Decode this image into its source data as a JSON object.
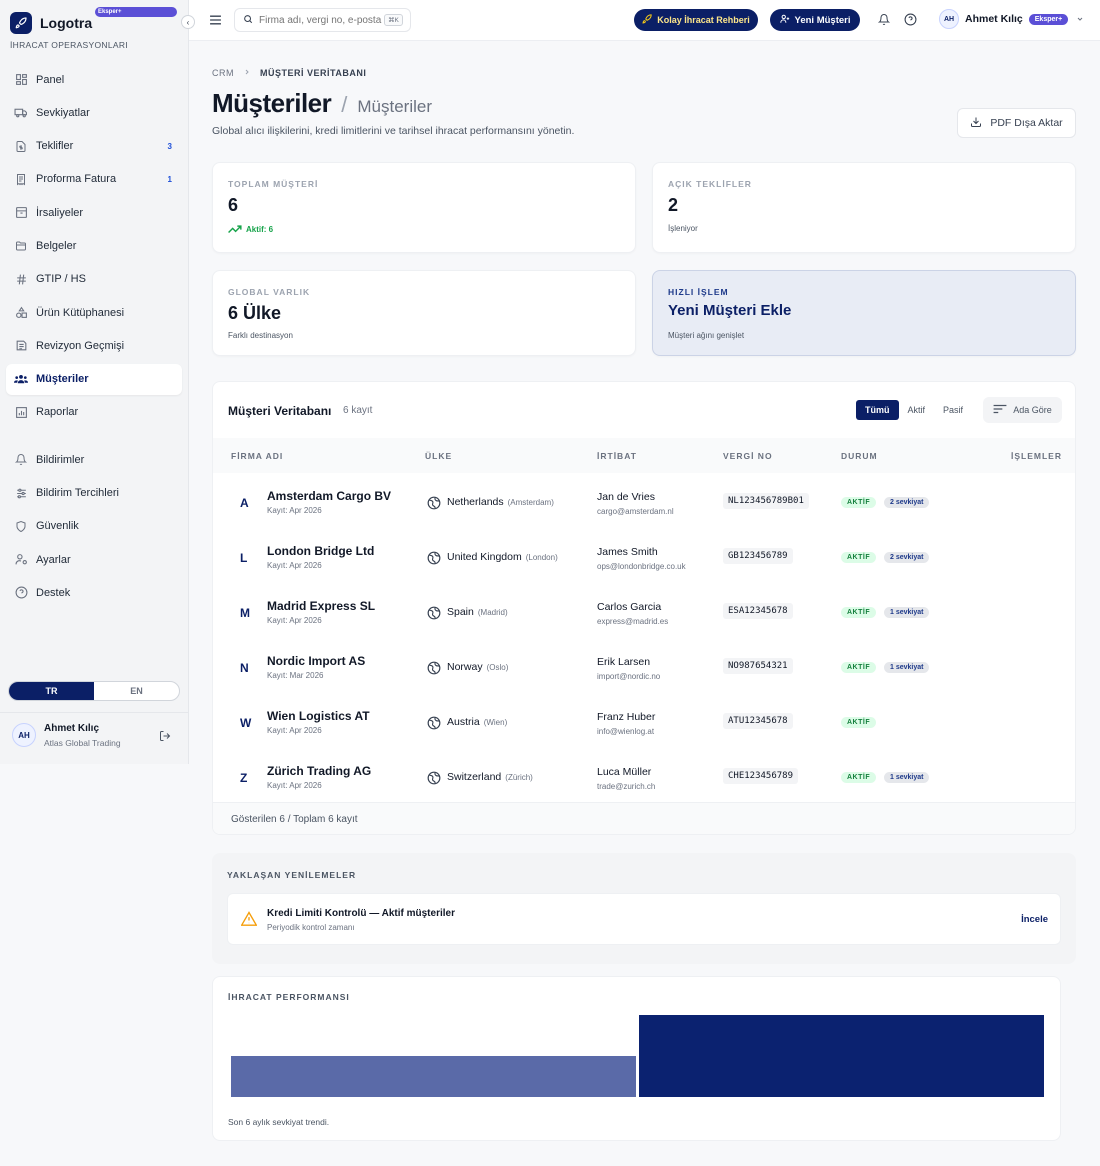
{
  "brand": {
    "name": "Logotra",
    "badge": "Eksper+",
    "subtitle": "İHRACAT OPERASYONLARI"
  },
  "sidebar": {
    "items": [
      {
        "label": "Panel",
        "icon": "grid-icon"
      },
      {
        "label": "Sevkiyatlar",
        "icon": "truck-icon"
      },
      {
        "label": "Teklifler",
        "icon": "document-dollar-icon",
        "count": "3"
      },
      {
        "label": "Proforma Fatura",
        "icon": "receipt-icon",
        "count": "1"
      },
      {
        "label": "İrsaliyeler",
        "icon": "archive-icon"
      },
      {
        "label": "Belgeler",
        "icon": "folder-icon"
      },
      {
        "label": "GTIP / HS",
        "icon": "hash-icon"
      },
      {
        "label": "Ürün Kütüphanesi",
        "icon": "shapes-icon"
      },
      {
        "label": "Revizyon Geçmişi",
        "icon": "history-icon"
      },
      {
        "label": "Müşteriler",
        "icon": "users-icon",
        "active": true
      },
      {
        "label": "Raporlar",
        "icon": "bar-chart-icon"
      }
    ],
    "items2": [
      {
        "label": "Bildirimler",
        "icon": "bell-icon"
      },
      {
        "label": "Bildirim Tercihleri",
        "icon": "sliders-icon"
      },
      {
        "label": "Güvenlik",
        "icon": "shield-icon"
      },
      {
        "label": "Ayarlar",
        "icon": "user-cog-icon"
      },
      {
        "label": "Destek",
        "icon": "help-circle-icon"
      }
    ],
    "lang": {
      "tr": "TR",
      "en": "EN"
    },
    "user": {
      "initials": "AH",
      "name": "Ahmet Kılıç",
      "company": "Atlas Global Trading"
    }
  },
  "topbar": {
    "search_placeholder": "Firma adı, vergi no, e-posta",
    "search_kbd": "⌘K",
    "guide_label": "Kolay İhracat Rehberi",
    "new_customer_label": "Yeni Müşteri",
    "user_initials": "AH",
    "user_name": "Ahmet Kılıç",
    "user_badge": "Eksper+"
  },
  "page": {
    "crumb1": "CRM",
    "crumb2": "MÜŞTERİ VERİTABANI",
    "title": "Müşteriler",
    "subtitle": "Müşteriler",
    "description": "Global alıcı ilişkilerini, kredi limitlerini ve tarihsel ihracat performansını yönetin.",
    "pdf_label": "PDF Dışa Aktar"
  },
  "stats": {
    "total": {
      "label": "TOPLAM MÜŞTERİ",
      "value": "6",
      "trend": "Aktif: 6"
    },
    "quotes": {
      "label": "AÇIK TEKLİFLER",
      "value": "2",
      "sub": "İşleniyor"
    },
    "global": {
      "label": "GLOBAL VARLIK",
      "value": "6 Ülke",
      "sub": "Farklı destinasyon"
    },
    "quick": {
      "label": "HIZLI İŞLEM",
      "value": "Yeni Müşteri Ekle",
      "sub": "Müşteri ağını genişlet"
    }
  },
  "table": {
    "title": "Müşteri Veritabanı",
    "count": "6 kayıt",
    "filters": [
      "Tümü",
      "Aktif",
      "Pasif"
    ],
    "sort_label": "Ada Göre",
    "columns": [
      "FİRMA ADI",
      "ÜLKE",
      "İRTİBAT",
      "VERGİ NO",
      "DURUM",
      "İŞLEMLER"
    ],
    "rows": [
      {
        "initial": "A",
        "name": "Amsterdam Cargo BV",
        "date": "Kayıt: Apr 2026",
        "country": "Netherlands",
        "city": "(Amsterdam)",
        "contact": "Jan de Vries",
        "email": "cargo@amsterdam.nl",
        "tax": "NL123456789B01",
        "status": "AKTİF",
        "shipments": "2 sevkiyat"
      },
      {
        "initial": "L",
        "name": "London Bridge Ltd",
        "date": "Kayıt: Apr 2026",
        "country": "United Kingdom",
        "city": "(London)",
        "contact": "James Smith",
        "email": "ops@londonbridge.co.uk",
        "tax": "GB123456789",
        "status": "AKTİF",
        "shipments": "2 sevkiyat"
      },
      {
        "initial": "M",
        "name": "Madrid Express SL",
        "date": "Kayıt: Apr 2026",
        "country": "Spain",
        "city": "(Madrid)",
        "contact": "Carlos Garcia",
        "email": "express@madrid.es",
        "tax": "ESA12345678",
        "status": "AKTİF",
        "shipments": "1 sevkiyat"
      },
      {
        "initial": "N",
        "name": "Nordic Import AS",
        "date": "Kayıt: Mar 2026",
        "country": "Norway",
        "city": "(Oslo)",
        "contact": "Erik Larsen",
        "email": "import@nordic.no",
        "tax": "NO987654321",
        "status": "AKTİF",
        "shipments": "1 sevkiyat"
      },
      {
        "initial": "W",
        "name": "Wien Logistics AT",
        "date": "Kayıt: Apr 2026",
        "country": "Austria",
        "city": "(Wien)",
        "contact": "Franz Huber",
        "email": "info@wienlog.at",
        "tax": "ATU12345678",
        "status": "AKTİF",
        "shipments": ""
      },
      {
        "initial": "Z",
        "name": "Zürich Trading AG",
        "date": "Kayıt: Apr 2026",
        "country": "Switzerland",
        "city": "(Zürich)",
        "contact": "Luca Müller",
        "email": "trade@zurich.ch",
        "tax": "CHE123456789",
        "status": "AKTİF",
        "shipments": "1 sevkiyat"
      }
    ],
    "footer": "Gösterilen 6 / Toplam 6 kayıt"
  },
  "renewals": {
    "label": "YAKLAŞAN YENİLEMELER",
    "item_title": "Kredi Limiti Kontrolü — Aktif müşteriler",
    "item_sub": "Periyodik kontrol zamanı",
    "action": "İncele"
  },
  "performance": {
    "label": "İHRACAT PERFORMANSI",
    "caption": "Son 6 aylık sevkiyat trendi."
  },
  "chart_data": {
    "type": "bar",
    "values": [
      1,
      2
    ],
    "ylim": [
      0,
      2
    ],
    "colors": [
      "#5a6aa8",
      "#0b2270"
    ]
  }
}
